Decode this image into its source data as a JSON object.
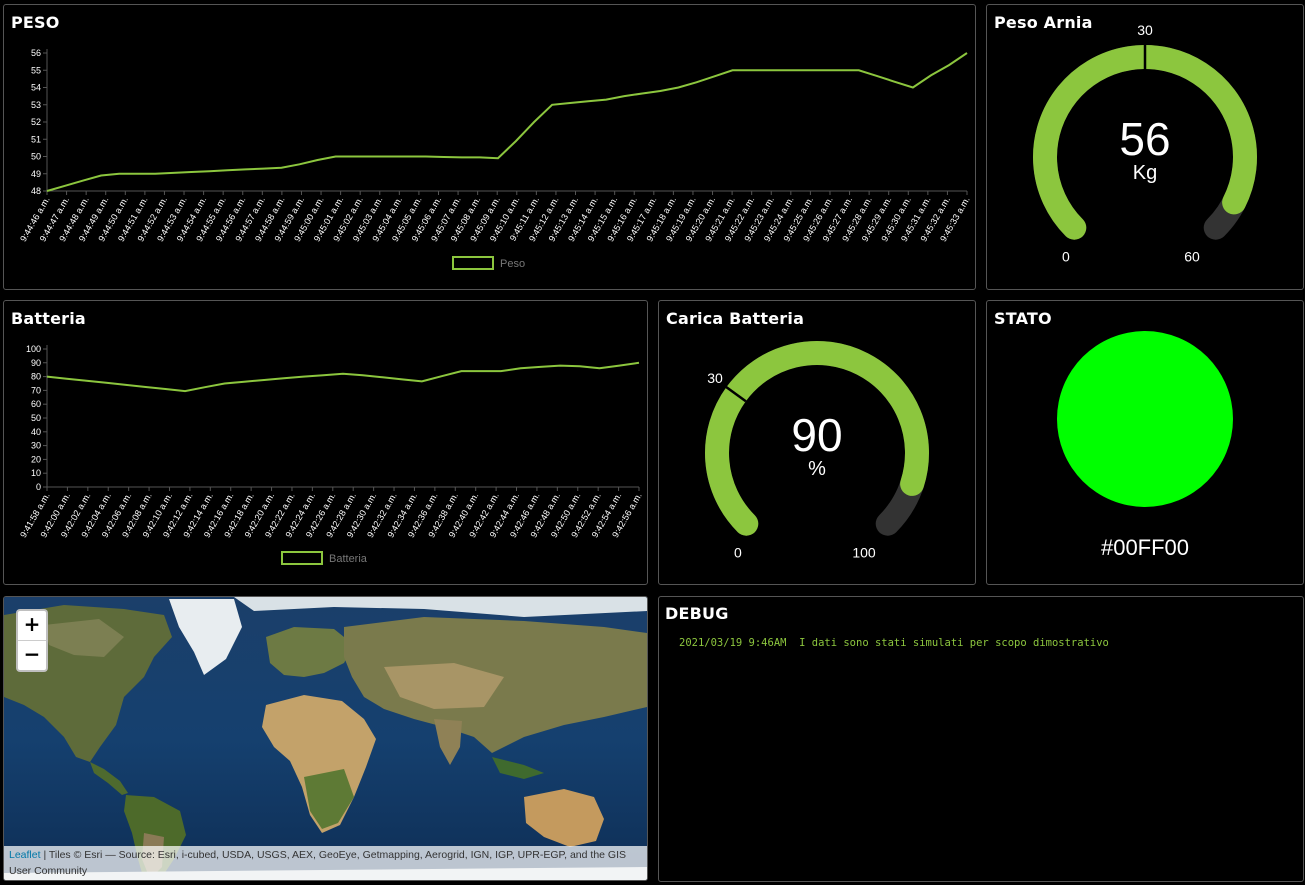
{
  "colors": {
    "accent": "#8cc63e",
    "track": "#333333",
    "stato": "#00FF00"
  },
  "peso_chart": {
    "title": "PESO",
    "chart_data": {
      "type": "line",
      "title": "PESO",
      "categories": [
        "9:44:46 a.m.",
        "9:44:47 a.m.",
        "9:44:48 a.m.",
        "9:44:49 a.m.",
        "9:44:50 a.m.",
        "9:44:51 a.m.",
        "9:44:52 a.m.",
        "9:44:53 a.m.",
        "9:44:54 a.m.",
        "9:44:55 a.m.",
        "9:44:56 a.m.",
        "9:44:57 a.m.",
        "9:44:58 a.m.",
        "9:44:59 a.m.",
        "9:45:00 a.m.",
        "9:45:01 a.m.",
        "9:45:02 a.m.",
        "9:45:03 a.m.",
        "9:45:04 a.m.",
        "9:45:05 a.m.",
        "9:45:06 a.m.",
        "9:45:07 a.m.",
        "9:45:08 a.m.",
        "9:45:09 a.m.",
        "9:45:10 a.m.",
        "9:45:11 a.m.",
        "9:45:12 a.m.",
        "9:45:13 a.m.",
        "9:45:14 a.m.",
        "9:45:15 a.m.",
        "9:45:16 a.m.",
        "9:45:17 a.m.",
        "9:45:18 a.m.",
        "9:45:19 a.m.",
        "9:45:20 a.m.",
        "9:45:21 a.m.",
        "9:45:22 a.m.",
        "9:45:23 a.m.",
        "9:45:24 a.m.",
        "9:45:25 a.m.",
        "9:45:26 a.m.",
        "9:45:27 a.m.",
        "9:45:28 a.m.",
        "9:45:29 a.m.",
        "9:45:30 a.m.",
        "9:45:31 a.m.",
        "9:45:32 a.m.",
        "9:45:33 a.m."
      ],
      "series": [
        {
          "name": "Peso",
          "values": [
            48,
            48.3,
            48.6,
            48.9,
            49,
            49,
            49,
            49.05,
            49.1,
            49.15,
            49.2,
            49.25,
            49.3,
            49.35,
            49.55,
            49.8,
            50,
            50,
            50,
            50,
            50,
            50,
            49.97,
            49.95,
            49.95,
            49.9,
            50.9,
            52,
            53,
            53.1,
            53.2,
            53.3,
            53.5,
            53.65,
            53.8,
            54,
            54.3,
            54.65,
            55,
            55,
            55,
            55,
            55,
            55,
            55,
            55,
            54.67,
            54.33,
            54,
            54.7,
            55.3,
            56
          ],
          "x_positions_note": ""
        }
      ],
      "ylim": [
        48,
        56
      ],
      "yticks": [
        "48",
        "49",
        "50",
        "51",
        "52",
        "53",
        "54",
        "55",
        "56"
      ],
      "legend": "bottom-center"
    }
  },
  "peso_gauge": {
    "title": "Peso Arnia",
    "value": "56",
    "unit": "Kg",
    "min": "0",
    "max": "60",
    "mid": "30",
    "numeric_value": 56,
    "numeric_min": 0,
    "numeric_max": 60,
    "numeric_mid": 30
  },
  "batteria_chart": {
    "title": "Batteria",
    "chart_data": {
      "type": "line",
      "title": "Batteria",
      "categories": [
        "9:41:58 a.m.",
        "9:42:00 a.m.",
        "9:42:02 a.m.",
        "9:42:04 a.m.",
        "9:42:06 a.m.",
        "9:42:08 a.m.",
        "9:42:10 a.m.",
        "9:42:12 a.m.",
        "9:42:14 a.m.",
        "9:42:16 a.m.",
        "9:42:18 a.m.",
        "9:42:20 a.m.",
        "9:42:22 a.m.",
        "9:42:24 a.m.",
        "9:42:26 a.m.",
        "9:42:28 a.m.",
        "9:42:30 a.m.",
        "9:42:32 a.m.",
        "9:42:34 a.m.",
        "9:42:36 a.m.",
        "9:42:38 a.m.",
        "9:42:40 a.m.",
        "9:42:42 a.m.",
        "9:42:44 a.m.",
        "9:42:46 a.m.",
        "9:42:48 a.m.",
        "9:42:50 a.m.",
        "9:42:52 a.m.",
        "9:42:54 a.m.",
        "9:42:56 a.m."
      ],
      "series": [
        {
          "name": "Batteria",
          "values": [
            80,
            78.5,
            77,
            75.5,
            74,
            72.5,
            71,
            69.5,
            72.3,
            75,
            76.3,
            77.5,
            78.8,
            80,
            81,
            82,
            81,
            79.5,
            78,
            76.5,
            80.3,
            84,
            84,
            84,
            86,
            87,
            88,
            87.5,
            86,
            88,
            90
          ]
        }
      ],
      "ylim": [
        0,
        100
      ],
      "yticks": [
        "0",
        "10",
        "20",
        "30",
        "40",
        "50",
        "60",
        "70",
        "80",
        "90",
        "100"
      ],
      "legend": "bottom-center"
    }
  },
  "carica_gauge": {
    "title": "Carica Batteria",
    "value": "90",
    "unit": "%",
    "min": "0",
    "max": "100",
    "mid": "30",
    "numeric_value": 90,
    "numeric_min": 0,
    "numeric_max": 100,
    "numeric_mid": 30
  },
  "stato": {
    "title": "STATO",
    "color_label": "#00FF00"
  },
  "map": {
    "zoom_in": "+",
    "zoom_out": "−",
    "attribution_link": "Leaflet",
    "attribution_text": " | Tiles © Esri — Source: Esri, i-cubed, USDA, USGS, AEX, GeoEye, Getmapping, Aerogrid, IGN, IGP, UPR-EGP, and the GIS User Community"
  },
  "debug": {
    "title": "DEBUG",
    "line": "2021/03/19 9:46AM  I dati sono stati simulati per scopo dimostrativo"
  }
}
